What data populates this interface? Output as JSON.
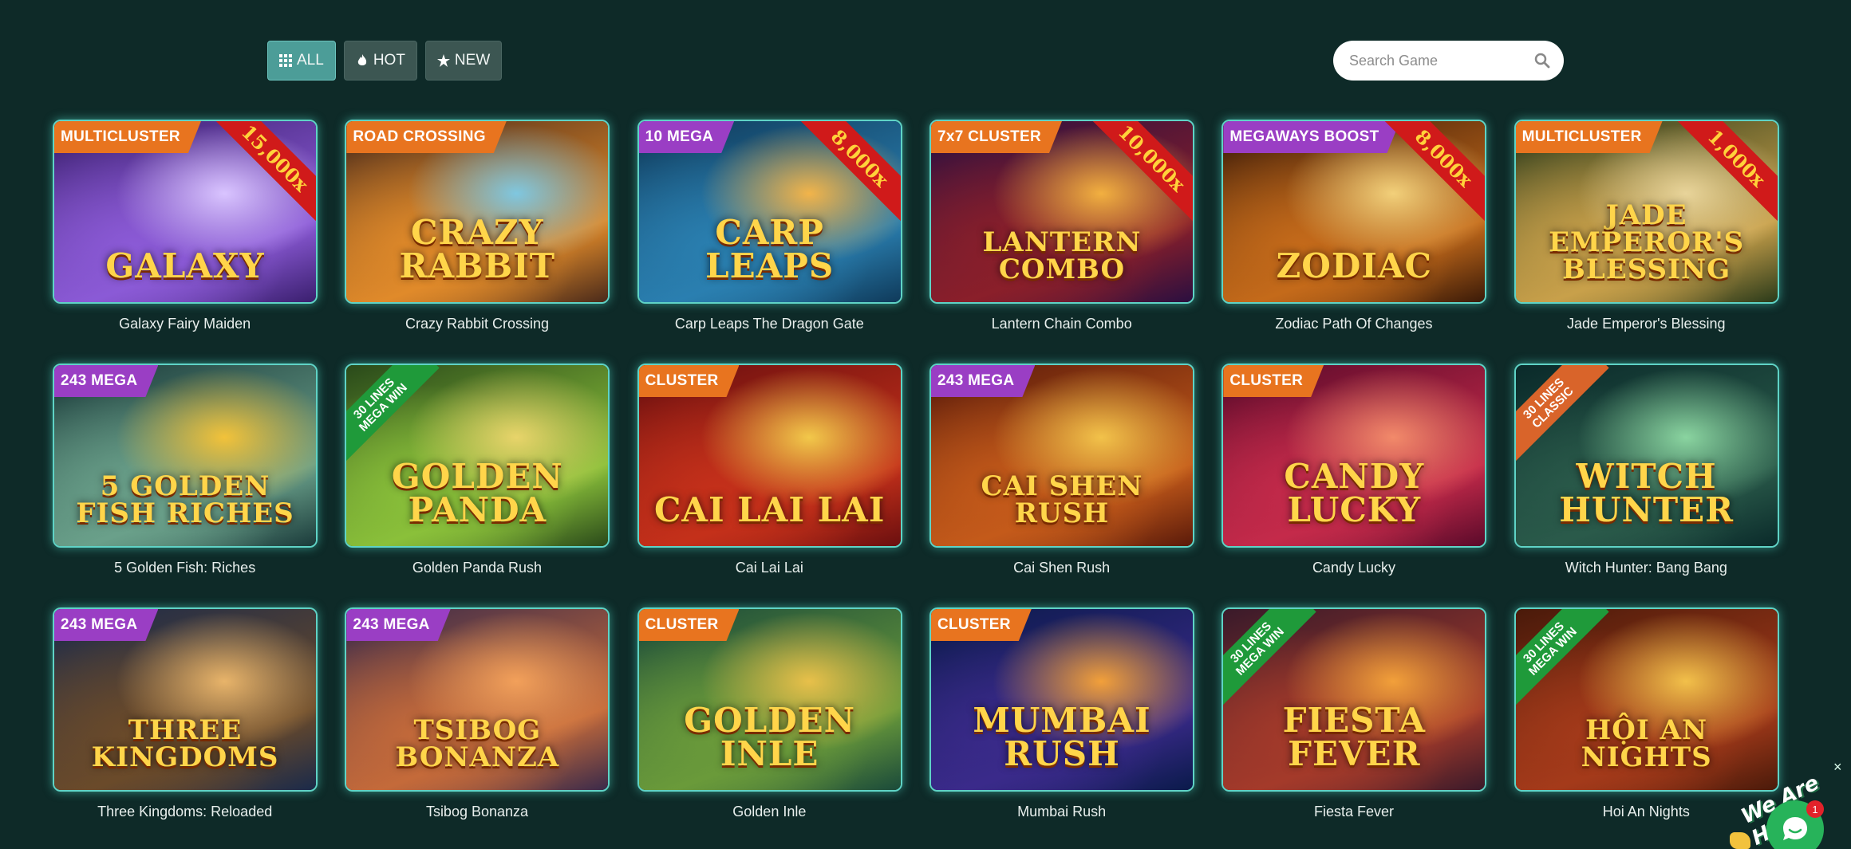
{
  "filters": [
    {
      "label": "ALL",
      "icon": "grid-icon",
      "active": true
    },
    {
      "label": "HOT",
      "icon": "fire-icon",
      "active": false
    },
    {
      "label": "NEW",
      "icon": "star-icon",
      "active": false
    }
  ],
  "search": {
    "placeholder": "Search Game",
    "icon": "search-icon"
  },
  "games": [
    {
      "title": "Galaxy Fairy Maiden",
      "logo": "GALAXY",
      "tag": "MULTICLUSTER",
      "tag_color": "orange",
      "corner": "15,000x"
    },
    {
      "title": "Crazy Rabbit Crossing",
      "logo": "CRAZY RABBIT",
      "tag": "ROAD CROSSING",
      "tag_color": "orange",
      "corner": ""
    },
    {
      "title": "Carp Leaps The Dragon Gate",
      "logo": "CARP LEAPS",
      "tag": "10 MEGA",
      "tag_color": "purple",
      "corner": "8,000x"
    },
    {
      "title": "Lantern Chain Combo",
      "logo": "LANTERN COMBO",
      "tag": "7x7 CLUSTER",
      "tag_color": "orange",
      "corner": "10,000x"
    },
    {
      "title": "Zodiac Path Of Changes",
      "logo": "ZODIAC",
      "tag": "MEGAWAYS BOOST",
      "tag_color": "purple",
      "corner": "8,000x"
    },
    {
      "title": "Jade Emperor's Blessing",
      "logo": "JADE EMPEROR'S BLESSING",
      "tag": "MULTICLUSTER",
      "tag_color": "orange",
      "corner": "1,000x"
    },
    {
      "title": "5 Golden Fish: Riches",
      "logo": "5 GOLDEN FISH RICHES",
      "tag": "243 MEGA",
      "tag_color": "purple",
      "corner": ""
    },
    {
      "title": "Golden Panda Rush",
      "logo": "GOLDEN PANDA",
      "tag": "",
      "tag_color": "",
      "corner": "",
      "diag": [
        "30 LINES",
        "MEGA WIN"
      ],
      "diag_color": "green"
    },
    {
      "title": "Cai Lai Lai",
      "logo": "CAI LAI LAI",
      "tag": "CLUSTER",
      "tag_color": "orange",
      "corner": ""
    },
    {
      "title": "Cai Shen Rush",
      "logo": "CAI SHEN RUSH",
      "tag": "243 MEGA",
      "tag_color": "purple",
      "corner": ""
    },
    {
      "title": "Candy Lucky",
      "logo": "CANDY LUCKY",
      "tag": "CLUSTER",
      "tag_color": "orange",
      "corner": ""
    },
    {
      "title": "Witch Hunter: Bang Bang",
      "logo": "WITCH HUNTER",
      "tag": "",
      "tag_color": "",
      "corner": "",
      "diag": [
        "30 LINES",
        "CLASSIC"
      ],
      "diag_color": "orange"
    },
    {
      "title": "Three Kingdoms: Reloaded",
      "logo": "THREE KINGDOMS",
      "tag": "243 MEGA",
      "tag_color": "purple",
      "corner": ""
    },
    {
      "title": "Tsibog Bonanza",
      "logo": "TSIBOG BONANZA",
      "tag": "243 MEGA",
      "tag_color": "purple",
      "corner": ""
    },
    {
      "title": "Golden Inle",
      "logo": "GOLDEN INLE",
      "tag": "CLUSTER",
      "tag_color": "orange",
      "corner": ""
    },
    {
      "title": "Mumbai Rush",
      "logo": "MUMBAI RUSH",
      "tag": "CLUSTER",
      "tag_color": "orange",
      "corner": ""
    },
    {
      "title": "Fiesta Fever",
      "logo": "FIESTA FEVER",
      "tag": "",
      "tag_color": "",
      "corner": "",
      "diag": [
        "30 LINES",
        "MEGA WIN"
      ],
      "diag_color": "green"
    },
    {
      "title": "Hoi An Nights",
      "logo": "HỘI AN NIGHTS",
      "tag": "",
      "tag_color": "",
      "corner": "",
      "diag": [
        "30 LINES",
        "MEGA WIN"
      ],
      "diag_color": "green"
    }
  ],
  "chat": {
    "banner": "We Are Here!",
    "badge": "1",
    "close": "×"
  }
}
